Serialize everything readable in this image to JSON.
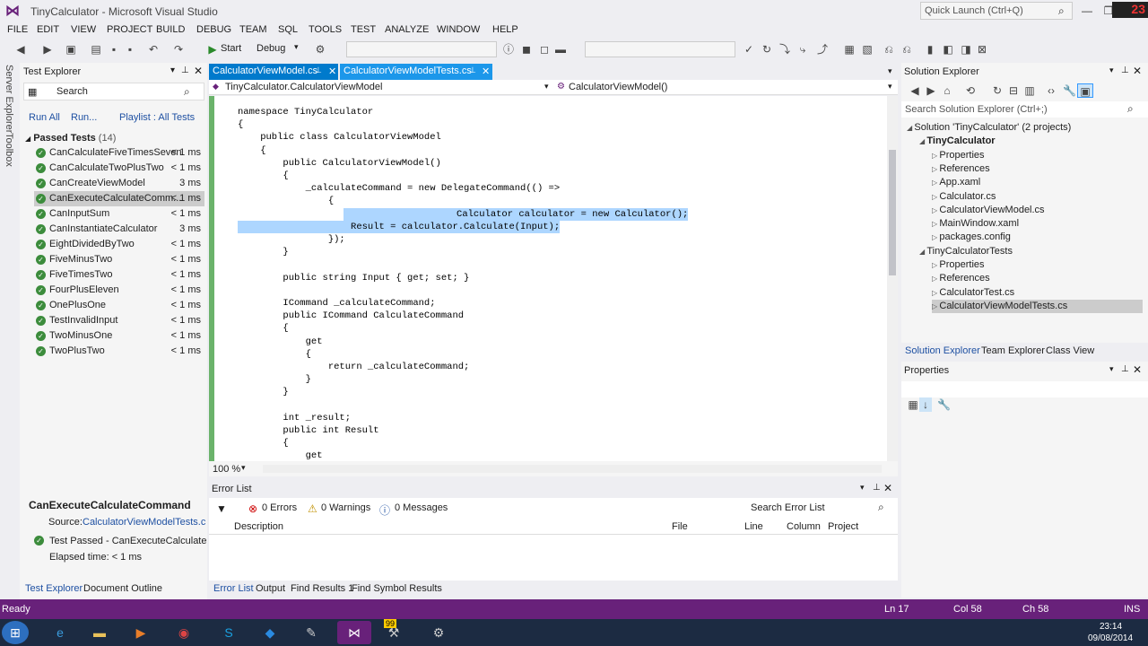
{
  "window": {
    "title": "TinyCalculator - Microsoft Visual Studio",
    "quick_launch_placeholder": "Quick Launch (Ctrl+Q)",
    "clock_badge": "23"
  },
  "menu": [
    "FILE",
    "EDIT",
    "VIEW",
    "PROJECT",
    "BUILD",
    "DEBUG",
    "TEAM",
    "SQL",
    "TOOLS",
    "TEST",
    "ANALYZE",
    "WINDOW",
    "HELP"
  ],
  "toolbar": {
    "start_label": "Start",
    "config": "Debug"
  },
  "sidebar_tabs": [
    "Server Explorer",
    "Toolbox"
  ],
  "test_explorer": {
    "title": "Test Explorer",
    "search_placeholder": "Search",
    "run_all": "Run All",
    "run": "Run...",
    "playlist": "Playlist : All Tests",
    "group_label": "Passed Tests",
    "group_count": "(14)",
    "tests": [
      {
        "name": "CanCalculateFiveTimesSeven",
        "time": "< 1 ms"
      },
      {
        "name": "CanCalculateTwoPlusTwo",
        "time": "< 1 ms"
      },
      {
        "name": "CanCreateViewModel",
        "time": "3 ms"
      },
      {
        "name": "CanExecuteCalculateComm...",
        "time": "< 1 ms"
      },
      {
        "name": "CanInputSum",
        "time": "< 1 ms"
      },
      {
        "name": "CanInstantiateCalculator",
        "time": "3 ms"
      },
      {
        "name": "EightDividedByTwo",
        "time": "< 1 ms"
      },
      {
        "name": "FiveMinusTwo",
        "time": "< 1 ms"
      },
      {
        "name": "FiveTimesTwo",
        "time": "< 1 ms"
      },
      {
        "name": "FourPlusEleven",
        "time": "< 1 ms"
      },
      {
        "name": "OnePlusOne",
        "time": "< 1 ms"
      },
      {
        "name": "TestInvalidInput",
        "time": "< 1 ms"
      },
      {
        "name": "TwoMinusOne",
        "time": "< 1 ms"
      },
      {
        "name": "TwoPlusTwo",
        "time": "< 1 ms"
      }
    ],
    "detail_title": "CanExecuteCalculateCommand",
    "detail_source_label": "Source:",
    "detail_source": "CalculatorViewModelTests.cs li",
    "detail_status": "Test Passed - CanExecuteCalculateCor",
    "detail_elapsed": "Elapsed time: < 1 ms",
    "bottom_tabs": [
      "Test Explorer",
      "Document Outline"
    ]
  },
  "editor": {
    "tabs": [
      "CalculatorViewModel.cs",
      "CalculatorViewModelTests.cs"
    ],
    "nav_left": "TinyCalculator.CalculatorViewModel",
    "nav_right": "CalculatorViewModel()",
    "zoom": "100 %",
    "lines": [
      "namespace TinyCalculator",
      "{",
      "    public class CalculatorViewModel",
      "    {",
      "        public CalculatorViewModel()",
      "        {",
      "            _calculateCommand = new DelegateCommand(() =>",
      "                {",
      "                    Calculator calculator = new Calculator();",
      "                    Result = calculator.Calculate(Input);",
      "                });",
      "        }",
      "",
      "        public string Input { get; set; }",
      "",
      "        ICommand _calculateCommand;",
      "        public ICommand CalculateCommand",
      "        {",
      "            get",
      "            {",
      "                return _calculateCommand;",
      "            }",
      "        }",
      "",
      "        int _result;",
      "        public int Result",
      "        {",
      "            get"
    ]
  },
  "error_list": {
    "title": "Error List",
    "errors": "0 Errors",
    "warnings": "0 Warnings",
    "messages": "0 Messages",
    "search_placeholder": "Search Error List",
    "columns": [
      "Description",
      "File",
      "Line",
      "Column",
      "Project"
    ],
    "bottom_tabs": [
      "Error List",
      "Output",
      "Find Results 1",
      "Find Symbol Results"
    ]
  },
  "solution_explorer": {
    "title": "Solution Explorer",
    "search_placeholder": "Search Solution Explorer (Ctrl+;)",
    "items": [
      {
        "label": "Solution 'TinyCalculator' (2 projects)",
        "indent": 0
      },
      {
        "label": "TinyCalculator",
        "indent": 1,
        "bold": true
      },
      {
        "label": "Properties",
        "indent": 2
      },
      {
        "label": "References",
        "indent": 2
      },
      {
        "label": "App.xaml",
        "indent": 2
      },
      {
        "label": "Calculator.cs",
        "indent": 2
      },
      {
        "label": "CalculatorViewModel.cs",
        "indent": 2
      },
      {
        "label": "MainWindow.xaml",
        "indent": 2
      },
      {
        "label": "packages.config",
        "indent": 2
      },
      {
        "label": "TinyCalculatorTests",
        "indent": 1
      },
      {
        "label": "Properties",
        "indent": 2
      },
      {
        "label": "References",
        "indent": 2
      },
      {
        "label": "CalculatorTest.cs",
        "indent": 2
      },
      {
        "label": "CalculatorViewModelTests.cs",
        "indent": 2
      }
    ],
    "bottom_tabs": [
      "Solution Explorer",
      "Team Explorer",
      "Class View"
    ]
  },
  "properties": {
    "title": "Properties"
  },
  "status": {
    "ready": "Ready",
    "ln": "Ln 17",
    "col": "Col 58",
    "ch": "Ch 58",
    "ins": "INS"
  },
  "taskbar": {
    "time": "23:14",
    "date": "09/08/2014",
    "badge": "99"
  }
}
